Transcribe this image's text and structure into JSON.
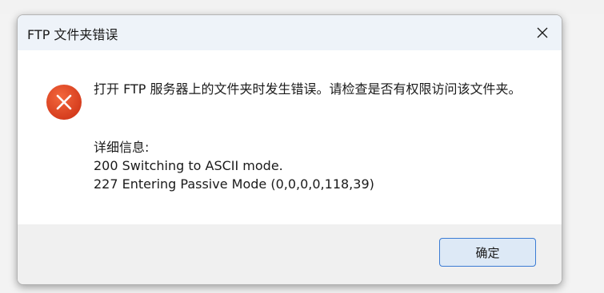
{
  "dialog": {
    "title": "FTP 文件夹错误",
    "message": "打开 FTP 服务器上的文件夹时发生错误。请检查是否有权限访问该文件夹。",
    "details_heading": "详细信息:",
    "details_lines": [
      "200 Switching to ASCII mode.",
      "227 Entering Passive Mode (0,0,0,0,118,39)"
    ],
    "ok_label": "确定",
    "icons": {
      "close": "close-icon",
      "error": "error-icon"
    },
    "colors": {
      "error_icon": "#e2481f",
      "button_border": "#3b7bd4",
      "button_fill": "#dde9f6",
      "titlebar": "#eef3f9"
    }
  }
}
